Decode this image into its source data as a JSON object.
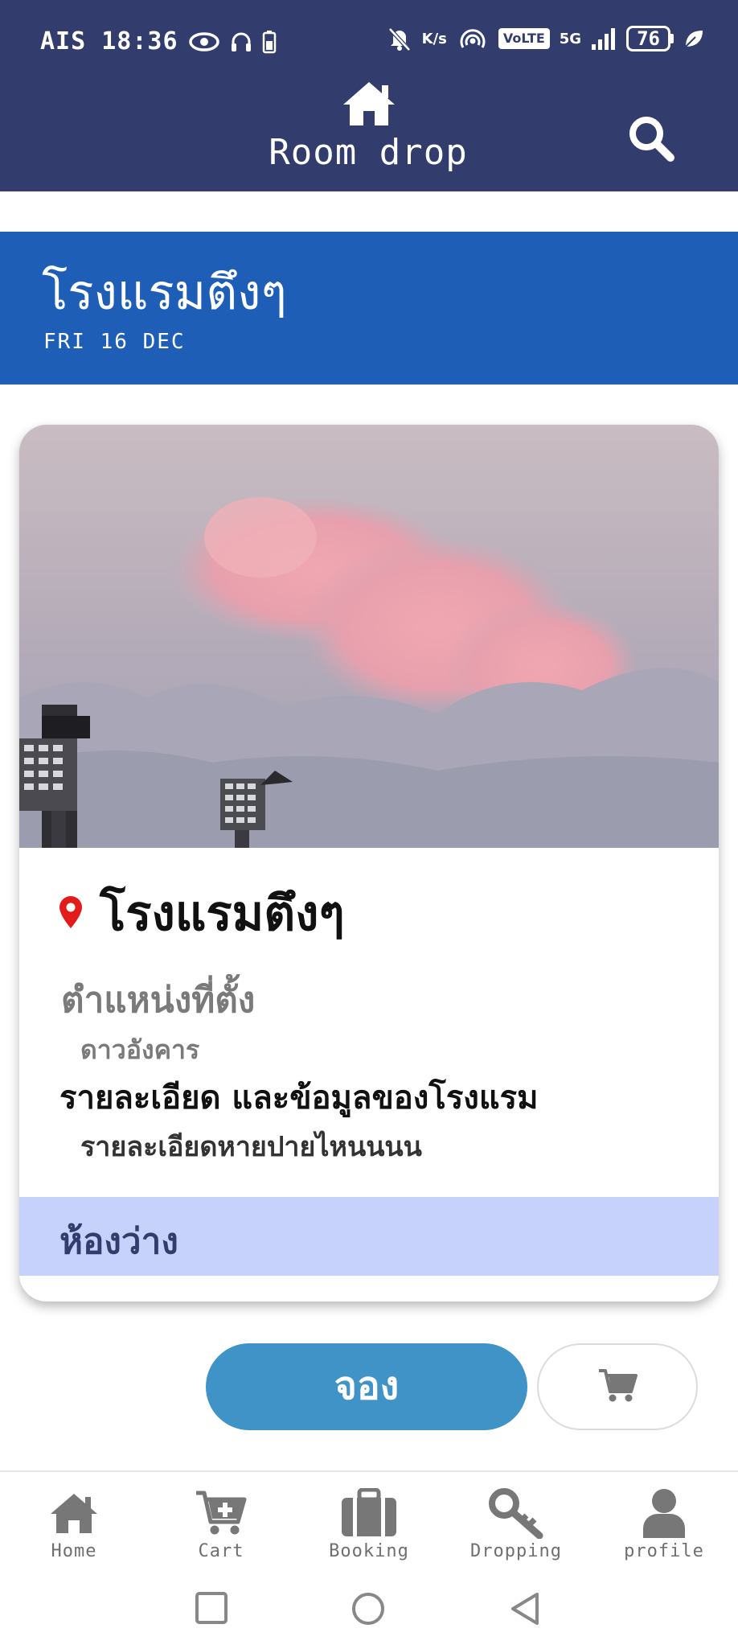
{
  "status_bar": {
    "carrier_time": "AIS 18:36",
    "net_speed": "K/s",
    "volte": "VoLTE",
    "network": "5G",
    "battery": "76"
  },
  "header": {
    "app_title": "Room drop",
    "icons": [
      "home-icon",
      "search-icon"
    ]
  },
  "banner": {
    "hotel_name": "โรงแรมตึงๆ",
    "date": "FRI 16 DEC"
  },
  "card": {
    "hotel_name": "โรงแรมตึงๆ",
    "location_label": "ตำแหน่งที่ตั้ง",
    "location_value": "ดาวอังคาร",
    "details_label": "รายละเอียด และข้อมูลของโรงแรม",
    "details_value": "รายละเอียดหายปายไหนนนน",
    "available_label": "ห้องว่าง"
  },
  "actions": {
    "book_label": "จอง",
    "cart_icon": "cart-icon"
  },
  "bottom_nav": {
    "items": [
      {
        "label": "Home",
        "icon": "home-icon"
      },
      {
        "label": "Cart",
        "icon": "cart-plus-icon"
      },
      {
        "label": "Booking",
        "icon": "suitcase-icon"
      },
      {
        "label": "Dropping",
        "icon": "key-icon"
      },
      {
        "label": "profile",
        "icon": "user-icon"
      }
    ]
  },
  "colors": {
    "header_bg": "#323d6e",
    "banner_bg": "#1f5eb6",
    "book_button": "#3f93c6",
    "available_bg": "#c6d2fb",
    "pin_red": "#e31b1b"
  }
}
